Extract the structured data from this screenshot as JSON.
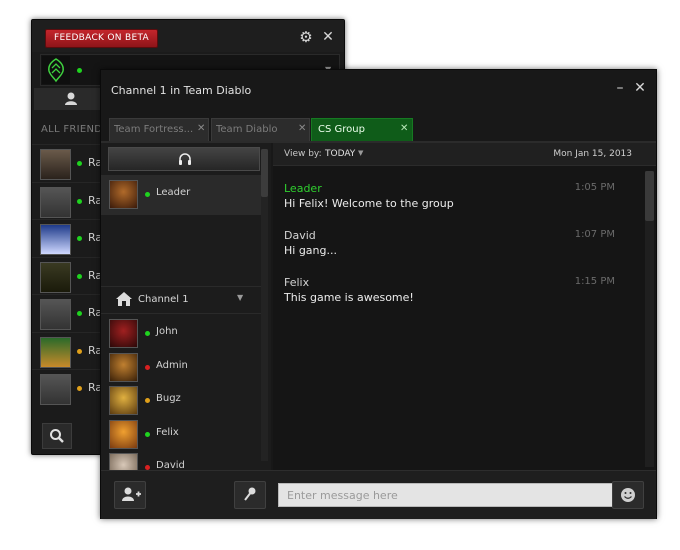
{
  "friends_window": {
    "feedback_label": "FEEDBACK ON BETA",
    "all_friends_label": "ALL FRIENDS",
    "friends": [
      {
        "name": "Ra",
        "status": "green"
      },
      {
        "name": "Ra",
        "status": "green"
      },
      {
        "name": "Ra",
        "status": "green"
      },
      {
        "name": "Ra",
        "status": "green"
      },
      {
        "name": "Ra",
        "status": "green"
      },
      {
        "name": "Ra",
        "status": "yellow"
      },
      {
        "name": "Ra",
        "status": "yellow"
      }
    ]
  },
  "chat_window": {
    "title": "Channel 1 in Team Diablo",
    "tabs": [
      {
        "label": "Team Fortress...",
        "active": false
      },
      {
        "label": "Team Diablo",
        "active": false
      },
      {
        "label": "CS Group",
        "active": true
      }
    ],
    "leader": {
      "name": "Leader",
      "status": "green"
    },
    "channel_name": "Channel 1",
    "members": [
      {
        "name": "John",
        "status": "green"
      },
      {
        "name": "Admin",
        "status": "red"
      },
      {
        "name": "Bugz",
        "status": "yellow"
      },
      {
        "name": "Felix",
        "status": "green"
      },
      {
        "name": "David",
        "status": "red"
      }
    ],
    "view_by_label": "View by:",
    "view_by_value": "TODAY",
    "date": "Mon Jan 15, 2013",
    "messages": [
      {
        "sender": "Leader",
        "time": "1:05 PM",
        "text": "Hi Felix! Welcome to the group",
        "sender_color": "#2fd02f"
      },
      {
        "sender": "David",
        "time": "1:07 PM",
        "text": "Hi gang..."
      },
      {
        "sender": "Felix",
        "time": "1:15 PM",
        "text": "This game is awesome!"
      }
    ],
    "input_placeholder": "Enter message here"
  },
  "colors": {
    "accent_red": "#b81e24",
    "active_tab_green": "#0f5c19",
    "leader_name_green": "#2fd02f",
    "status_online": "#1fd31f",
    "status_busy": "#d82020",
    "status_away": "#e0a01a"
  },
  "icons": [
    "gear-icon",
    "close-icon",
    "user-icon",
    "search-icon",
    "headset-icon",
    "home-icon",
    "chevron-down-icon",
    "add-user-icon",
    "microphone-icon",
    "smiley-icon",
    "minimize-icon",
    "razer-logo"
  ]
}
